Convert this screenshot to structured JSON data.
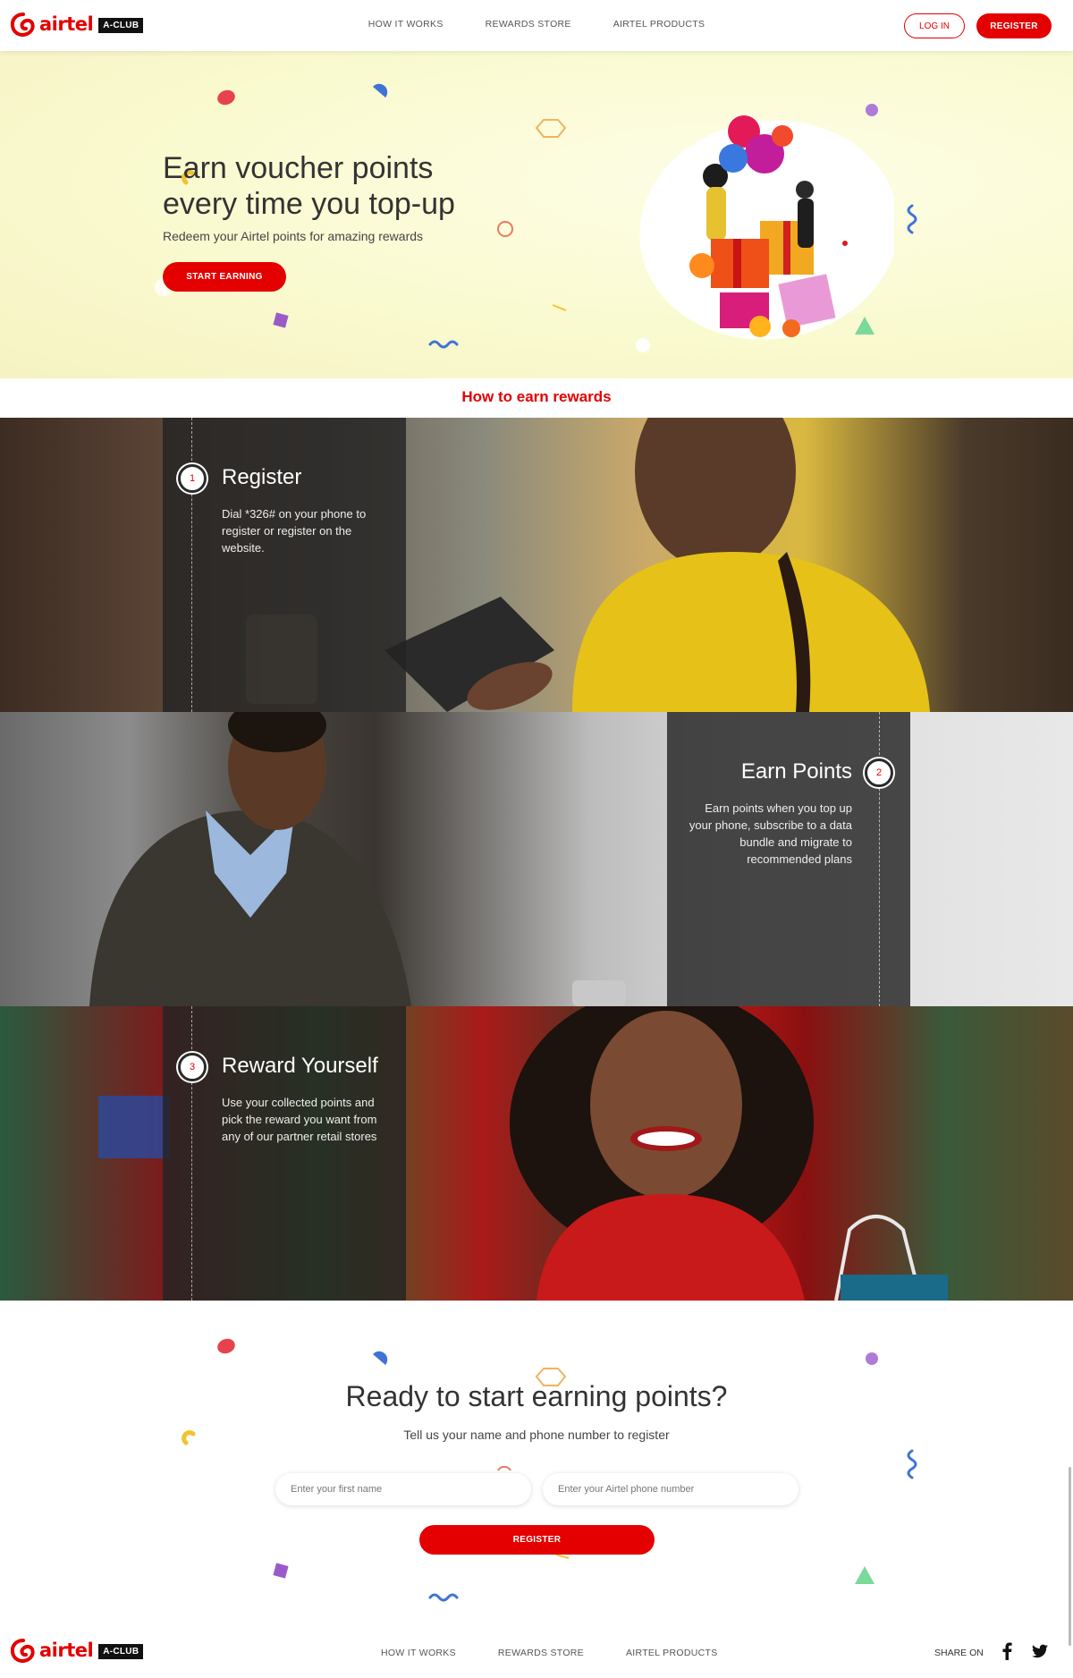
{
  "header": {
    "logo_word": "airtel",
    "logo_badge": "A-CLUB",
    "nav": [
      "HOW IT WORKS",
      "REWARDS STORE",
      "AIRTEL PRODUCTS"
    ],
    "login_label": "LOG IN",
    "register_label": "REGISTER"
  },
  "hero": {
    "title": "Earn voucher points every time you top-up",
    "subtitle": "Redeem your Airtel points for amazing rewards",
    "cta_label": "START EARNING"
  },
  "how_to": {
    "title": "How to earn rewards",
    "steps": [
      {
        "number": "1",
        "title": "Register",
        "text": "Dial *326# on your phone to register or register on the website."
      },
      {
        "number": "2",
        "title": "Earn Points",
        "text": "Earn points when you top up your phone, subscribe to a data bundle and migrate to recommended plans"
      },
      {
        "number": "3",
        "title": "Reward Yourself",
        "text": "Use your collected points and pick the reward you want from any of our partner retail stores"
      }
    ]
  },
  "ready": {
    "title": "Ready to start earning points?",
    "subtitle": "Tell us your name and phone number to register",
    "first_name_placeholder": "Enter your first name",
    "phone_placeholder": "Enter your Airtel phone number",
    "register_label": "REGISTER"
  },
  "footer": {
    "logo_word": "airtel",
    "logo_badge": "A-CLUB",
    "nav": [
      "HOW IT WORKS",
      "REWARDS STORE",
      "AIRTEL PRODUCTS"
    ],
    "share_label": "SHARE ON",
    "social_icons": [
      "facebook-icon",
      "twitter-icon"
    ]
  },
  "colors": {
    "brand_red": "#e40000",
    "hero_bg": "#fafad0",
    "overlay": "#232323"
  }
}
